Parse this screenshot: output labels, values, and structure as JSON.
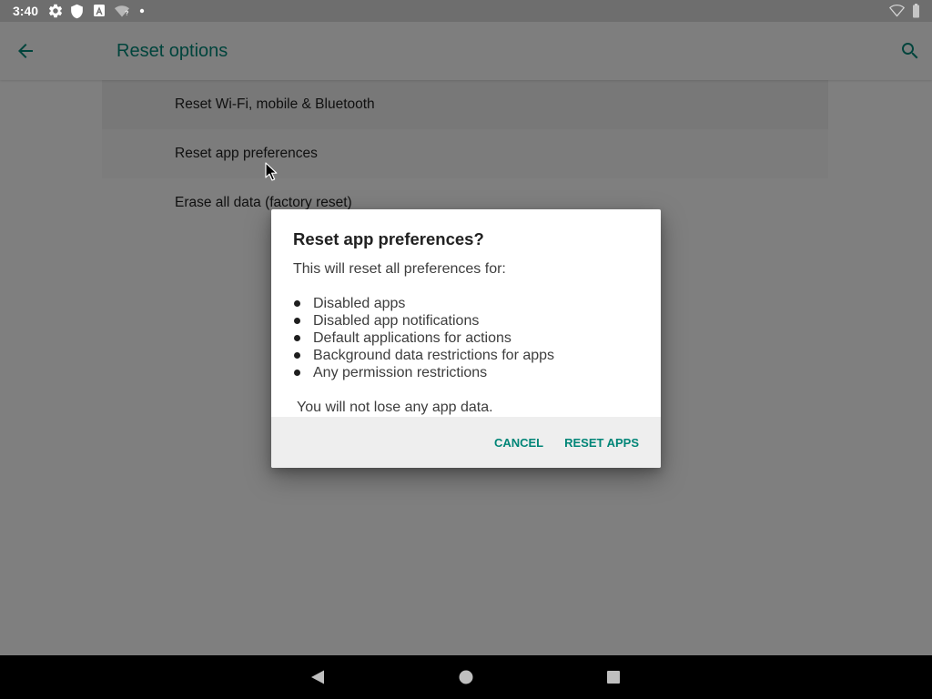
{
  "status_bar": {
    "time": "3:40",
    "left_icons": [
      "settings-gear-icon",
      "shield-icon",
      "a-box-icon",
      "wifi-question-icon",
      "notification-dot-icon"
    ],
    "right_icons": [
      "wifi-icon",
      "battery-icon"
    ]
  },
  "toolbar": {
    "title": "Reset options",
    "back_icon": "back-arrow-icon",
    "search_icon": "search-icon"
  },
  "options": [
    {
      "label": "Reset Wi-Fi, mobile & Bluetooth",
      "highlighted": true
    },
    {
      "label": "Reset app preferences",
      "hovered": true
    },
    {
      "label": "Erase all data (factory reset)"
    }
  ],
  "dialog": {
    "title": "Reset app preferences?",
    "intro": "This will reset all preferences for:",
    "items": [
      "Disabled apps",
      "Disabled app notifications",
      "Default applications for actions",
      "Background data restrictions for apps",
      "Any permission restrictions"
    ],
    "footer": "You will not lose any app data.",
    "buttons": {
      "cancel": "CANCEL",
      "confirm": "RESET APPS"
    }
  },
  "nav_bar": {
    "icons": [
      "nav-back-icon",
      "nav-home-icon",
      "nav-recents-icon"
    ]
  },
  "cursor": {
    "icon": "mouse-pointer-icon"
  },
  "colors": {
    "accent": "#008577",
    "status_bar": "#6e6e6e",
    "toolbar": "#f7f7f7",
    "background": "#fafafa",
    "highlight": "#ebebeb",
    "scrim": "#0000007d",
    "dialog_background": "#ffffff",
    "dialog_button_bar": "#eeeeee",
    "nav_bar": "#000000",
    "nav_icon": "#bfbfbf"
  }
}
